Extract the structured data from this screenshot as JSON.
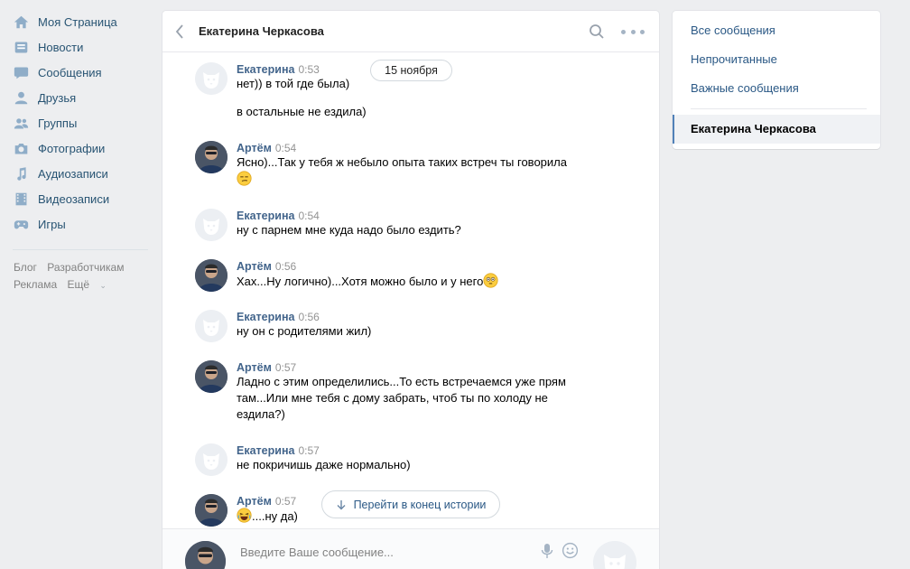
{
  "left_nav": {
    "items": [
      {
        "label": "Моя Страница",
        "icon": "home-icon"
      },
      {
        "label": "Новости",
        "icon": "news-icon"
      },
      {
        "label": "Сообщения",
        "icon": "messages-icon"
      },
      {
        "label": "Друзья",
        "icon": "friends-icon"
      },
      {
        "label": "Группы",
        "icon": "groups-icon"
      },
      {
        "label": "Фотографии",
        "icon": "camera-icon"
      },
      {
        "label": "Аудиозаписи",
        "icon": "music-icon"
      },
      {
        "label": "Видеозаписи",
        "icon": "video-icon"
      },
      {
        "label": "Игры",
        "icon": "gamepad-icon"
      }
    ],
    "footer": {
      "blog": "Блог",
      "developers": "Разработчикам",
      "ads": "Реклама",
      "more": "Ещё"
    }
  },
  "chat": {
    "title": "Екатерина Черкасова",
    "date_divider": "15 ноября",
    "messages": [
      {
        "author": "Екатерина",
        "time": "0:53",
        "lines": [
          "нет)) в той где была)"
        ],
        "extra": "в остальные не ездила)"
      },
      {
        "author": "Артём",
        "time": "0:54",
        "lines": [
          "Ясно)...Так у тебя ж небыло опыта таких встреч ты говорила"
        ]
      },
      {
        "author": "Екатерина",
        "time": "0:54",
        "lines": [
          "ну с парнем мне куда надо было ездить?"
        ]
      },
      {
        "author": "Артём",
        "time": "0:56",
        "lines": [
          "Хах...Ну логично)...Хотя можно было и у него"
        ]
      },
      {
        "author": "Екатерина",
        "time": "0:56",
        "lines": [
          "ну он с родителями жил)"
        ]
      },
      {
        "author": "Артём",
        "time": "0:57",
        "lines": [
          "Ладно с этим определились...То есть встречаемся уже прям",
          "там...Или мне тебя с дому забрать, чтоб ты по холоду не",
          "ездила?)"
        ]
      },
      {
        "author": "Екатерина",
        "time": "0:57",
        "lines": [
          "не покричишь даже нормально)"
        ]
      },
      {
        "author": "Артём",
        "time": "0:57",
        "lines": [
          "....ну да)"
        ]
      }
    ],
    "jump_label": "Перейти в конец истории",
    "composer": {
      "placeholder": "Введите Ваше сообщение..."
    }
  },
  "right_menu": {
    "all": "Все сообщения",
    "unread": "Непрочитанные",
    "important": "Важные сообщения",
    "active_conversation": "Екатерина Черкасова"
  },
  "colors": {
    "link": "#2a5885",
    "author": "#42648b",
    "nav_icon": "#8fadc8",
    "background": "#edeef0"
  }
}
